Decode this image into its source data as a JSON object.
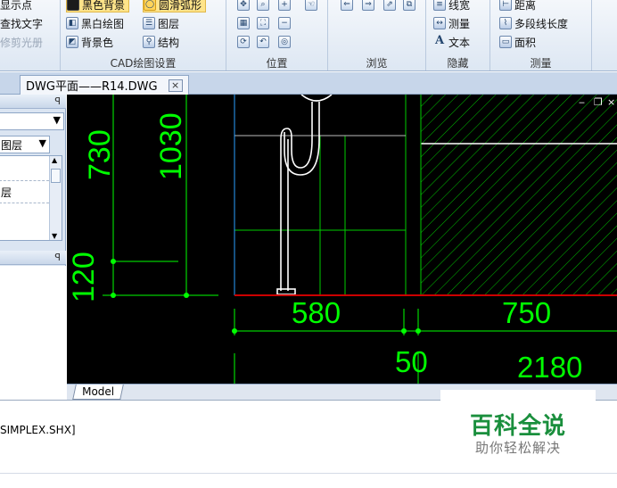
{
  "ribbon": {
    "group1": {
      "items": [
        "显示点",
        "查找文字",
        "修剪光册"
      ]
    },
    "group2": {
      "title": "CAD绘图设置",
      "items": [
        "黑色背景",
        "圆滑弧形",
        "黑白绘图",
        "图层",
        "背景色",
        "结构"
      ]
    },
    "group3": {
      "title": "位置"
    },
    "group4": {
      "title": "浏览"
    },
    "group5": {
      "title": "隐藏",
      "items": [
        "线宽",
        "测量",
        "文本"
      ]
    },
    "group6": {
      "title": "测量",
      "items": [
        "距离",
        "多段线长度",
        "面积"
      ]
    }
  },
  "tabs": {
    "document": "DWG平面——R14.DWG",
    "close_glyph": "×"
  },
  "left_panel": {
    "pin_glyph": "ꟼ",
    "layer_combo": "图层",
    "list_items": [
      "层"
    ]
  },
  "drawing": {
    "dimensions": [
      "730",
      "1030",
      "120",
      "580",
      "750",
      "50",
      "2180"
    ],
    "colors": {
      "background": "#000000",
      "dimension": "#00ff00",
      "walls": "#ffffff",
      "hatch": "#00cc00",
      "accent": "#ff0000"
    }
  },
  "model_tab": "Model",
  "command": {
    "text": "SIMPLEX.SHX]"
  },
  "watermark": {
    "title": "百科全说",
    "subtitle": "助你轻松解决"
  }
}
